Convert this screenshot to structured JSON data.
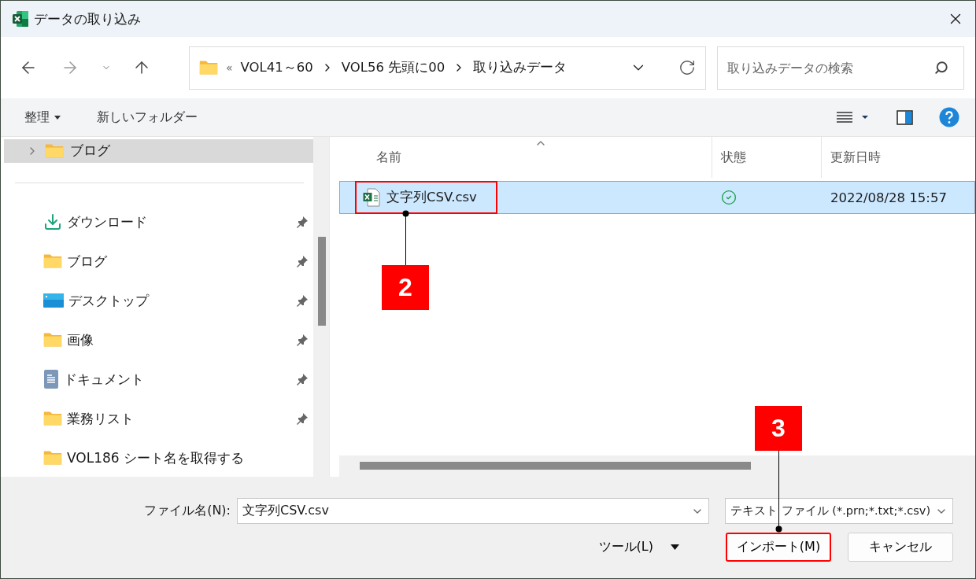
{
  "window": {
    "title": "データの取り込み"
  },
  "address_bar": {
    "overflow": "«",
    "path": [
      "VOL41～60",
      "VOL56 先頭に00",
      "取り込みデータ"
    ]
  },
  "search": {
    "placeholder": "取り込みデータの検索"
  },
  "commands": [
    {
      "label": "整理",
      "kind": "menu"
    },
    {
      "label": "新しいフォルダー",
      "kind": "plain"
    }
  ],
  "sidebar": {
    "top_items": [
      {
        "label": "ブログ",
        "expanded": false,
        "selected": true
      }
    ],
    "quick_access": [
      {
        "label": "ダウンロード",
        "kind": "download",
        "pinned": true
      },
      {
        "label": "ブログ",
        "kind": "folder",
        "pinned": true
      },
      {
        "label": "デスクトップ",
        "kind": "desktop",
        "pinned": true
      },
      {
        "label": "画像",
        "kind": "folder",
        "pinned": true
      },
      {
        "label": "ドキュメント",
        "kind": "document",
        "pinned": true
      },
      {
        "label": "業務リスト",
        "kind": "folder",
        "pinned": true
      },
      {
        "label": "VOL186 シート名を取得する",
        "kind": "folder",
        "pinned": false
      }
    ]
  },
  "table": {
    "columns": [
      "名前",
      "状態",
      "更新日時"
    ],
    "rows": [
      {
        "name": "文字列CSV.csv",
        "modified": "2022/08/28 15:57",
        "synced": true,
        "selected": true,
        "callout": "2"
      }
    ]
  },
  "footer": {
    "file_name_label": "ファイル名(N):",
    "file_name": "文字列CSV.csv",
    "file_type": "テキスト ファイル (*.prn;*.txt;*.csv)",
    "tools": "ツール(L)",
    "buttons": [
      {
        "label": "インポート(M)",
        "callout": "3"
      },
      {
        "label": "キャンセル"
      }
    ]
  }
}
